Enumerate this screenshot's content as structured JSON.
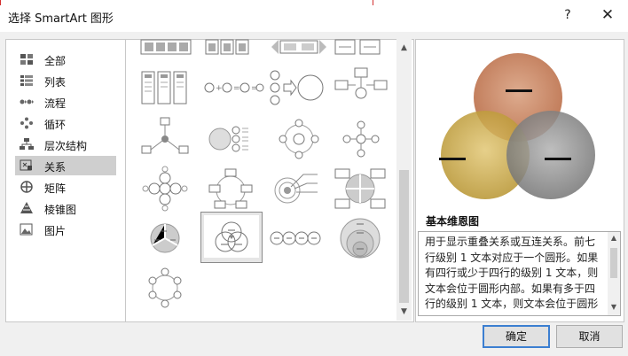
{
  "window": {
    "title": "选择 SmartArt 图形",
    "help_label": "?",
    "close_label": "✕"
  },
  "categories": [
    {
      "label": "全部",
      "icon": "grid-icon",
      "selected": false
    },
    {
      "label": "列表",
      "icon": "list-icon",
      "selected": false
    },
    {
      "label": "流程",
      "icon": "process-icon",
      "selected": false
    },
    {
      "label": "循环",
      "icon": "cycle-icon",
      "selected": false
    },
    {
      "label": "层次结构",
      "icon": "hierarchy-icon",
      "selected": false
    },
    {
      "label": "关系",
      "icon": "relationship-icon",
      "selected": true
    },
    {
      "label": "矩阵",
      "icon": "matrix-icon",
      "selected": false
    },
    {
      "label": "棱锥图",
      "icon": "pyramid-icon",
      "selected": false
    },
    {
      "label": "图片",
      "icon": "picture-icon",
      "selected": false
    }
  ],
  "gallery": {
    "selected_name": "基本维恩图"
  },
  "preview": {
    "title": "基本维恩图",
    "description": "用于显示重叠关系或互连关系。前七行级别 1 文本对应于一个圆形。如果有四行或少于四行的级别 1 文本，则文本会位于圆形内部。如果有多于四行的级别 1 文本，则文本会位于圆形",
    "circle_colors": [
      "#c8734a",
      "#c9a63a",
      "#8a8a8a"
    ],
    "circle_labels": [
      "—",
      "—",
      "—"
    ]
  },
  "buttons": {
    "ok": "确定",
    "cancel": "取消"
  }
}
